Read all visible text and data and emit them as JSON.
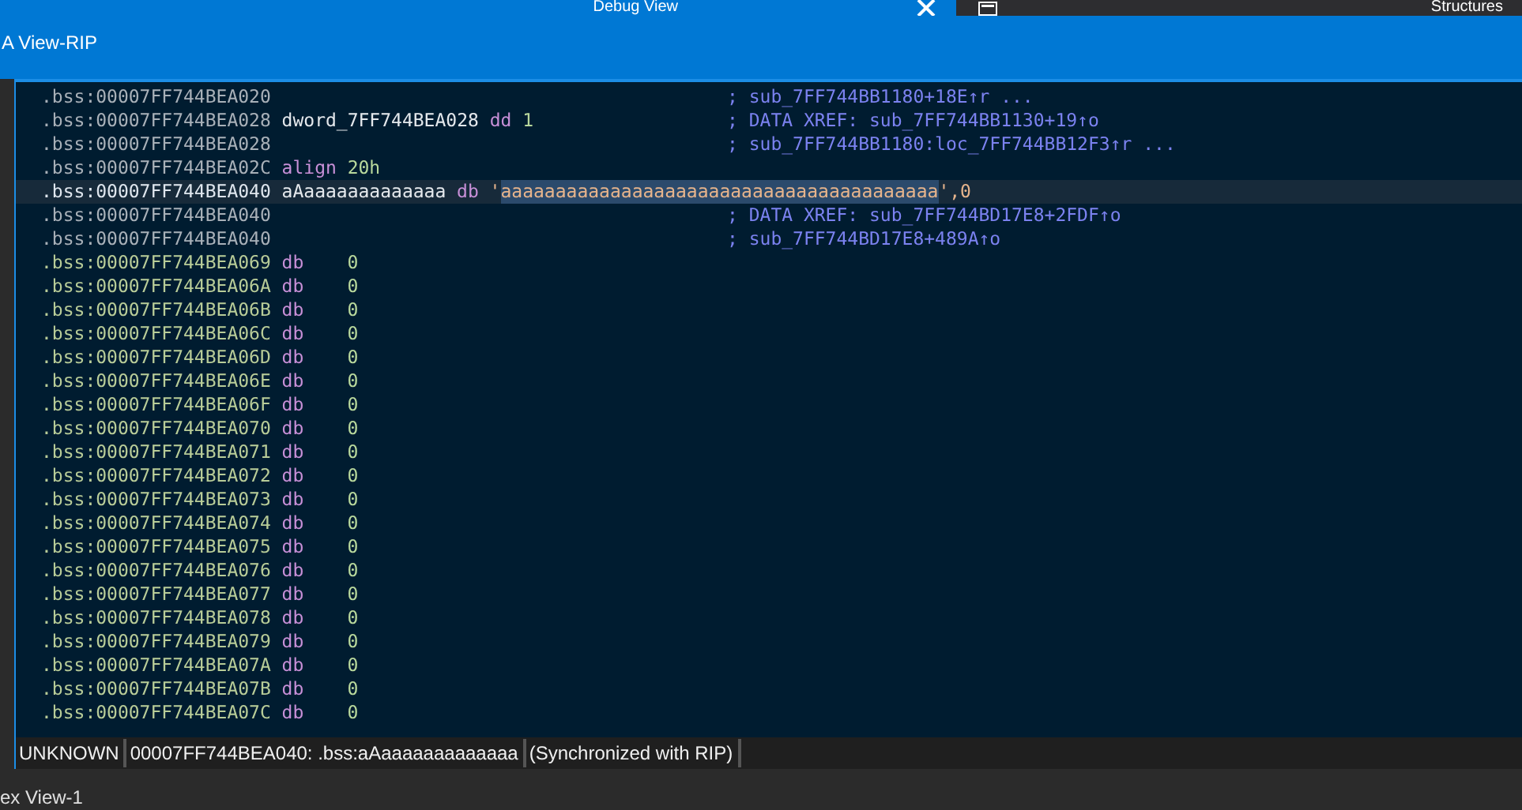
{
  "top_bar": {
    "tab_title": "Debug View",
    "panel_title": "Structures"
  },
  "view_tab": {
    "title": "A View-RIP"
  },
  "listing": {
    "rows": [
      {
        "kind": "plain",
        "selected": false,
        "address": ".bss:00007FF744BEA020",
        "comment": "; sub_7FF744BB1180+18E↑r ..."
      },
      {
        "kind": "plain",
        "selected": false,
        "address": ".bss:00007FF744BEA028",
        "label": "dword_7FF744BEA028",
        "mnemonic": "dd",
        "operand": "1",
        "comment": "; DATA XREF: sub_7FF744BB1130+19↑o"
      },
      {
        "kind": "plain",
        "selected": false,
        "address": ".bss:00007FF744BEA028",
        "comment": "; sub_7FF744BB1180:loc_7FF744BB12F3↑r ..."
      },
      {
        "kind": "plain",
        "selected": false,
        "address": ".bss:00007FF744BEA02C",
        "mnemonic": "align",
        "operand": "20h"
      },
      {
        "kind": "plain",
        "selected": true,
        "address": ".bss:00007FF744BEA040",
        "label": "aAaaaaaaaaaaaaa",
        "mnemonic": "db",
        "operand": "'",
        "selected_text": "aaaaaaaaaaaaaaaaaaaaaaaaaaaaaaaaaaaaaaaa",
        "operand_end": "',0"
      },
      {
        "kind": "plain",
        "selected": false,
        "address": ".bss:00007FF744BEA040",
        "comment": "; DATA XREF: sub_7FF744BD17E8+2FDF↑o"
      },
      {
        "kind": "plain",
        "selected": false,
        "address": ".bss:00007FF744BEA040",
        "comment": "; sub_7FF744BD17E8+489A↑o"
      },
      {
        "kind": "data",
        "selected": false,
        "address": ".bss:00007FF744BEA069",
        "mnemonic": "db",
        "operand": "0"
      },
      {
        "kind": "data",
        "selected": false,
        "address": ".bss:00007FF744BEA06A",
        "mnemonic": "db",
        "operand": "0"
      },
      {
        "kind": "data",
        "selected": false,
        "address": ".bss:00007FF744BEA06B",
        "mnemonic": "db",
        "operand": "0"
      },
      {
        "kind": "data",
        "selected": false,
        "address": ".bss:00007FF744BEA06C",
        "mnemonic": "db",
        "operand": "0"
      },
      {
        "kind": "data",
        "selected": false,
        "address": ".bss:00007FF744BEA06D",
        "mnemonic": "db",
        "operand": "0"
      },
      {
        "kind": "data",
        "selected": false,
        "address": ".bss:00007FF744BEA06E",
        "mnemonic": "db",
        "operand": "0"
      },
      {
        "kind": "data",
        "selected": false,
        "address": ".bss:00007FF744BEA06F",
        "mnemonic": "db",
        "operand": "0"
      },
      {
        "kind": "data",
        "selected": false,
        "address": ".bss:00007FF744BEA070",
        "mnemonic": "db",
        "operand": "0"
      },
      {
        "kind": "data",
        "selected": false,
        "address": ".bss:00007FF744BEA071",
        "mnemonic": "db",
        "operand": "0"
      },
      {
        "kind": "data",
        "selected": false,
        "address": ".bss:00007FF744BEA072",
        "mnemonic": "db",
        "operand": "0"
      },
      {
        "kind": "data",
        "selected": false,
        "address": ".bss:00007FF744BEA073",
        "mnemonic": "db",
        "operand": "0"
      },
      {
        "kind": "data",
        "selected": false,
        "address": ".bss:00007FF744BEA074",
        "mnemonic": "db",
        "operand": "0"
      },
      {
        "kind": "data",
        "selected": false,
        "address": ".bss:00007FF744BEA075",
        "mnemonic": "db",
        "operand": "0"
      },
      {
        "kind": "data",
        "selected": false,
        "address": ".bss:00007FF744BEA076",
        "mnemonic": "db",
        "operand": "0"
      },
      {
        "kind": "data",
        "selected": false,
        "address": ".bss:00007FF744BEA077",
        "mnemonic": "db",
        "operand": "0"
      },
      {
        "kind": "data",
        "selected": false,
        "address": ".bss:00007FF744BEA078",
        "mnemonic": "db",
        "operand": "0"
      },
      {
        "kind": "data",
        "selected": false,
        "address": ".bss:00007FF744BEA079",
        "mnemonic": "db",
        "operand": "0"
      },
      {
        "kind": "data",
        "selected": false,
        "address": ".bss:00007FF744BEA07A",
        "mnemonic": "db",
        "operand": "0"
      },
      {
        "kind": "data",
        "selected": false,
        "address": ".bss:00007FF744BEA07B",
        "mnemonic": "db",
        "operand": "0"
      },
      {
        "kind": "data",
        "selected": false,
        "address": ".bss:00007FF744BEA07C",
        "mnemonic": "db",
        "operand": "0"
      }
    ]
  },
  "status_bar": {
    "items": [
      "UNKNOWN",
      "00007FF744BEA040: .bss:aAaaaaaaaaaaaaa",
      "(Synchronized with RIP)"
    ]
  },
  "bottom_tab": {
    "title": "ex View-1"
  }
}
